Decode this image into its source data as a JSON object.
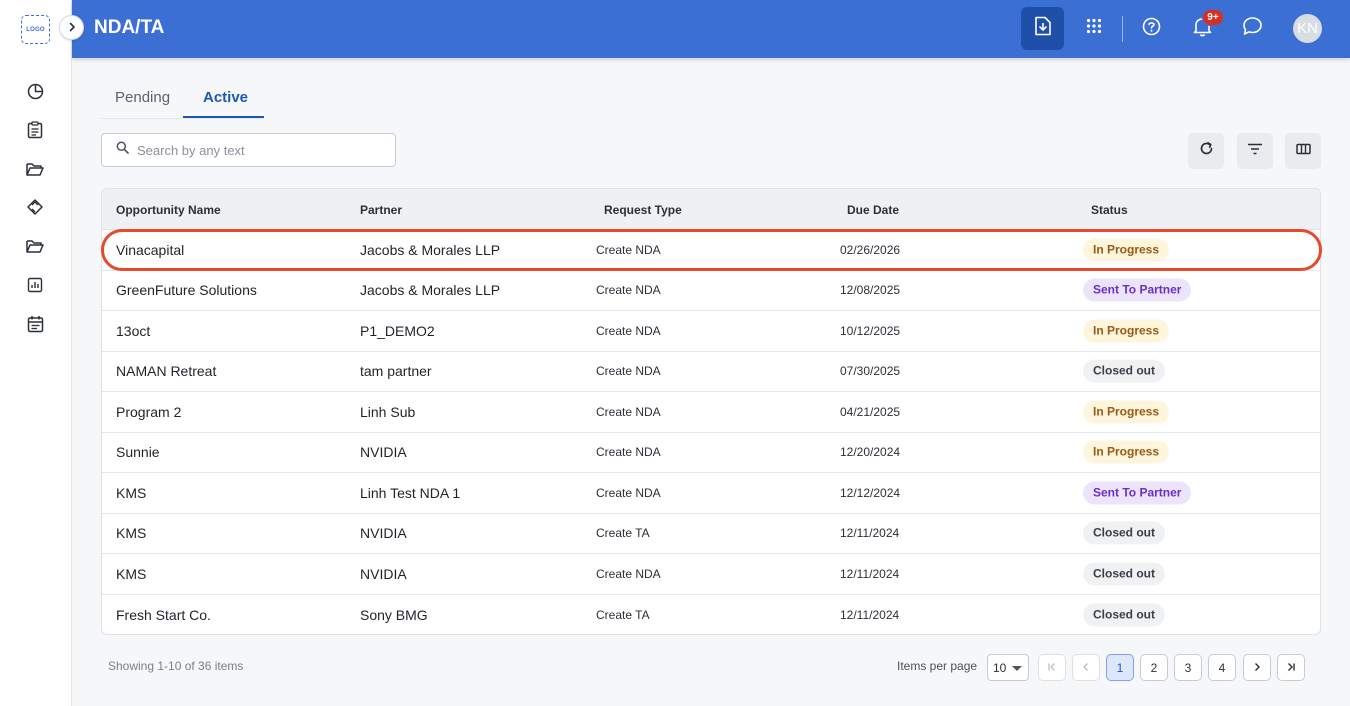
{
  "sidebar": {
    "logo_text": "LOGO",
    "items": [
      {
        "icon": "pie-chart-icon"
      },
      {
        "icon": "clipboard-icon"
      },
      {
        "icon": "folder-open-icon"
      },
      {
        "icon": "handshake-icon"
      },
      {
        "icon": "folder-icon"
      },
      {
        "icon": "bar-chart-icon"
      },
      {
        "icon": "calendar-icon"
      }
    ]
  },
  "header": {
    "title": "NDA/TA",
    "notification_count": "9+",
    "avatar_initials": "KN",
    "brand_color": "#3b6fd4"
  },
  "tabs": [
    {
      "label": "Pending",
      "active": false
    },
    {
      "label": "Active",
      "active": true
    }
  ],
  "search": {
    "placeholder": "Search by any text",
    "value": ""
  },
  "table": {
    "columns": [
      "Opportunity Name",
      "Partner",
      "Request Type",
      "Due Date",
      "Status"
    ],
    "rows": [
      {
        "opportunity": "Vinacapital",
        "partner": "Jacobs & Morales LLP",
        "request_type": "Create NDA",
        "due_date": "02/26/2026",
        "status": "In Progress",
        "status_kind": "progress"
      },
      {
        "opportunity": "GreenFuture Solutions",
        "partner": "Jacobs & Morales LLP",
        "request_type": "Create NDA",
        "due_date": "12/08/2025",
        "status": "Sent To Partner",
        "status_kind": "partner"
      },
      {
        "opportunity": "13oct",
        "partner": "P1_DEMO2",
        "request_type": "Create NDA",
        "due_date": "10/12/2025",
        "status": "In Progress",
        "status_kind": "progress"
      },
      {
        "opportunity": "NAMAN Retreat",
        "partner": "tam partner",
        "request_type": "Create NDA",
        "due_date": "07/30/2025",
        "status": "Closed out",
        "status_kind": "closed"
      },
      {
        "opportunity": "Program 2",
        "partner": "Linh Sub",
        "request_type": "Create NDA",
        "due_date": "04/21/2025",
        "status": "In Progress",
        "status_kind": "progress"
      },
      {
        "opportunity": "Sunnie",
        "partner": "NVIDIA",
        "request_type": "Create NDA",
        "due_date": "12/20/2024",
        "status": "In Progress",
        "status_kind": "progress"
      },
      {
        "opportunity": "KMS",
        "partner": "Linh Test NDA 1",
        "request_type": "Create NDA",
        "due_date": "12/12/2024",
        "status": "Sent To Partner",
        "status_kind": "partner"
      },
      {
        "opportunity": "KMS",
        "partner": "NVIDIA",
        "request_type": "Create TA",
        "due_date": "12/11/2024",
        "status": "Closed out",
        "status_kind": "closed"
      },
      {
        "opportunity": "KMS",
        "partner": "NVIDIA",
        "request_type": "Create NDA",
        "due_date": "12/11/2024",
        "status": "Closed out",
        "status_kind": "closed"
      },
      {
        "opportunity": "Fresh Start Co.",
        "partner": "Sony BMG",
        "request_type": "Create TA",
        "due_date": "12/11/2024",
        "status": "Closed out",
        "status_kind": "closed"
      }
    ],
    "highlight_color": "#e64a2e"
  },
  "footer": {
    "showing": "Showing 1-10 of 36 items",
    "items_per_page_label": "Items per page",
    "items_per_page": "10",
    "pages": [
      "1",
      "2",
      "3",
      "4"
    ],
    "current_page": "1"
  }
}
